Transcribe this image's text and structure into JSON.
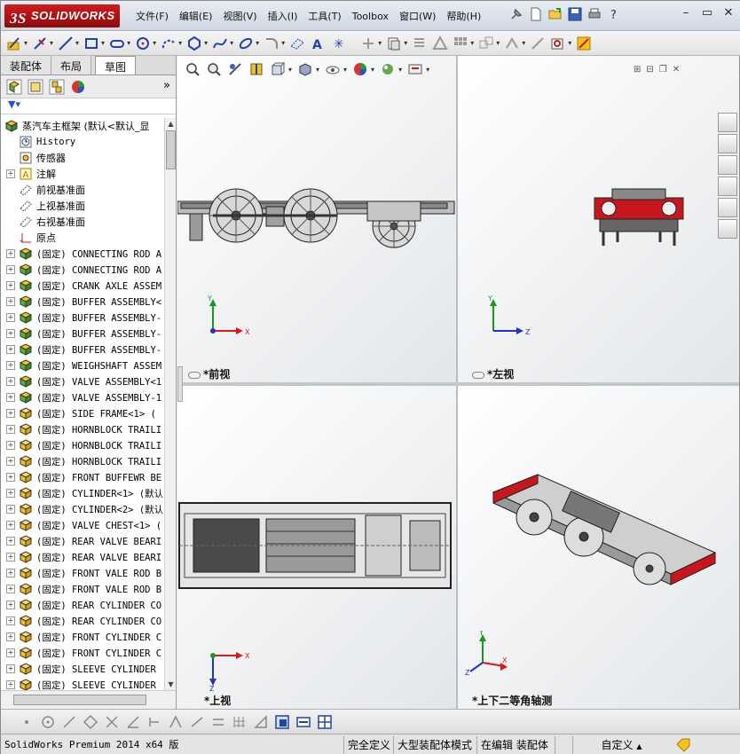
{
  "app": {
    "logo_text": "SOLIDWORKS",
    "logo_ds": "3S"
  },
  "menu": [
    "文件(F)",
    "编辑(E)",
    "视图(V)",
    "插入(I)",
    "工具(T)",
    "Toolbox",
    "窗口(W)",
    "帮助(H)"
  ],
  "tabs": [
    {
      "label": "装配体",
      "active": false
    },
    {
      "label": "布局",
      "active": false
    },
    {
      "label": "草图",
      "active": true
    }
  ],
  "tree": {
    "root": "蒸汽车主框架  (默认<默认_显",
    "items": [
      {
        "label": "History",
        "icon": "history-icon",
        "expandable": false,
        "mono": true
      },
      {
        "label": "传感器",
        "icon": "sensor-icon",
        "expandable": false
      },
      {
        "label": "注解",
        "icon": "annotation-icon",
        "expandable": true
      },
      {
        "label": "前视基准面",
        "icon": "plane-icon",
        "expandable": false
      },
      {
        "label": "上视基准面",
        "icon": "plane-icon",
        "expandable": false
      },
      {
        "label": "右视基准面",
        "icon": "plane-icon",
        "expandable": false
      },
      {
        "label": "原点",
        "icon": "origin-icon",
        "expandable": false
      },
      {
        "label": "(固定) CONNECTING ROD A",
        "icon": "assembly-icon",
        "expandable": true
      },
      {
        "label": "(固定) CONNECTING ROD A",
        "icon": "assembly-icon",
        "expandable": true
      },
      {
        "label": "(固定) CRANK AXLE ASSEM",
        "icon": "assembly-icon",
        "expandable": true
      },
      {
        "label": "(固定) BUFFER ASSEMBLY<",
        "icon": "assembly-icon",
        "expandable": true
      },
      {
        "label": "(固定) BUFFER ASSEMBLY-",
        "icon": "assembly-icon",
        "expandable": true
      },
      {
        "label": "(固定) BUFFER ASSEMBLY-",
        "icon": "assembly-icon",
        "expandable": true
      },
      {
        "label": "(固定) BUFFER ASSEMBLY-",
        "icon": "assembly-icon",
        "expandable": true
      },
      {
        "label": "(固定) WEIGHSHAFT ASSEM",
        "icon": "assembly-icon",
        "expandable": true
      },
      {
        "label": "(固定) VALVE ASSEMBLY<1",
        "icon": "assembly-icon",
        "expandable": true
      },
      {
        "label": "(固定) VALVE ASSEMBLY-1",
        "icon": "assembly-icon",
        "expandable": true
      },
      {
        "label": "(固定) SIDE FRAME<1> (",
        "icon": "part-icon",
        "expandable": true
      },
      {
        "label": "(固定) HORNBLOCK TRAILI",
        "icon": "part-icon",
        "expandable": true
      },
      {
        "label": "(固定) HORNBLOCK TRAILI",
        "icon": "part-icon",
        "expandable": true
      },
      {
        "label": "(固定) HORNBLOCK TRAILI",
        "icon": "part-icon",
        "expandable": true
      },
      {
        "label": "(固定) FRONT BUFFEWR BE",
        "icon": "part-icon",
        "expandable": true
      },
      {
        "label": "(固定) CYLINDER<1> (默认",
        "icon": "part-icon",
        "expandable": true
      },
      {
        "label": "(固定) CYLINDER<2> (默认",
        "icon": "part-icon",
        "expandable": true
      },
      {
        "label": "(固定) VALVE CHEST<1> (",
        "icon": "part-icon",
        "expandable": true
      },
      {
        "label": "(固定) REAR VALVE BEARI",
        "icon": "part-icon",
        "expandable": true
      },
      {
        "label": "(固定) REAR VALVE BEARI",
        "icon": "part-icon",
        "expandable": true
      },
      {
        "label": "(固定) FRONT VALE ROD B",
        "icon": "part-icon",
        "expandable": true
      },
      {
        "label": "(固定) FRONT VALE ROD B",
        "icon": "part-icon",
        "expandable": true
      },
      {
        "label": "(固定) REAR CYLINDER CO",
        "icon": "part-icon",
        "expandable": true
      },
      {
        "label": "(固定) REAR CYLINDER CO",
        "icon": "part-icon",
        "expandable": true
      },
      {
        "label": "(固定) FRONT CYLINDER C",
        "icon": "part-icon",
        "expandable": true
      },
      {
        "label": "(固定) FRONT CYLINDER C",
        "icon": "part-icon",
        "expandable": true
      },
      {
        "label": "(固定) SLEEVE CYLINDER",
        "icon": "part-icon",
        "expandable": true
      },
      {
        "label": "(固定) SLEEVE CYLINDER",
        "icon": "part-icon",
        "expandable": true
      }
    ]
  },
  "viewports": {
    "front": {
      "label": "*前视",
      "axes": [
        "Y",
        "X"
      ]
    },
    "left": {
      "label": "*左视",
      "axes": [
        "Y",
        "Z"
      ]
    },
    "top": {
      "label": "*上视",
      "axes": [
        "X",
        "Z"
      ]
    },
    "iso": {
      "label": "*上下二等角轴测",
      "axes": [
        "Y",
        "X",
        "Z"
      ]
    }
  },
  "status": {
    "product": "SolidWorks Premium 2014 x64 版",
    "definition": "完全定义",
    "mode": "大型装配体模式",
    "editing": "在编辑 装配体",
    "units": "自定义",
    "arrow": "▲"
  },
  "colors": {
    "brand_red": "#c8161d",
    "axis_x": "#d81a1a",
    "axis_y": "#1a9a1a",
    "axis_z": "#2233cc",
    "assembly_yellow": "#f4c21a"
  }
}
